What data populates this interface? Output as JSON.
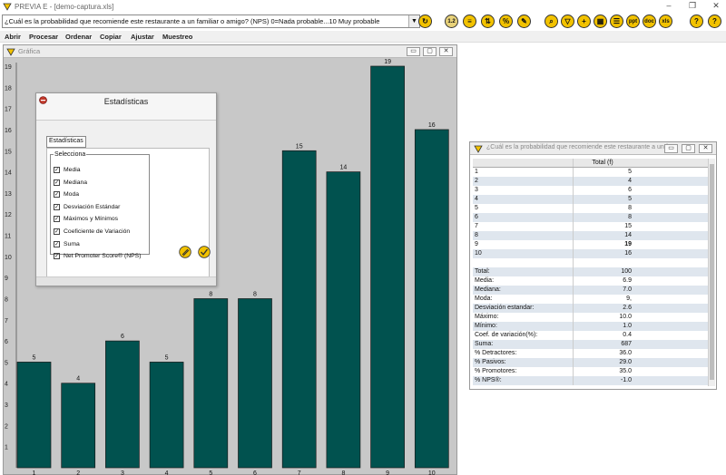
{
  "window": {
    "title": "PREVIA E - [demo-captura.xls]",
    "minimize": "–",
    "restore": "❐",
    "close": "✕"
  },
  "toolbar": {
    "question": "¿Cuál es la probabilidad que recomiende este restaurante a un familiar o amigo? (NPS) 0=Nada probable...10 Muy probable",
    "icons": [
      {
        "name": "refresh-icon",
        "glyph": "↻",
        "color": "#f2c200"
      },
      {
        "name": "scale-icon",
        "glyph": "1.2",
        "color": "#e8d27a"
      },
      {
        "name": "sort-asc-icon",
        "glyph": "≡",
        "color": "#f2c200"
      },
      {
        "name": "sort-desc-icon",
        "glyph": "⇅",
        "color": "#f2c200"
      },
      {
        "name": "percent-icon",
        "glyph": "%",
        "color": "#f2c200"
      },
      {
        "name": "edit-icon",
        "glyph": "✎",
        "color": "#f2c200"
      },
      {
        "name": "search-icon",
        "glyph": "⌕",
        "color": "#f2c200"
      },
      {
        "name": "filter-icon",
        "glyph": "▽",
        "color": "#f2c200"
      },
      {
        "name": "add-icon",
        "glyph": "+",
        "color": "#f2c200"
      },
      {
        "name": "grid-icon",
        "glyph": "▦",
        "color": "#f2c200"
      },
      {
        "name": "list-icon",
        "glyph": "☰",
        "color": "#f2c200"
      },
      {
        "name": "ppt-icon",
        "glyph": "ppt",
        "color": "#f2c200"
      },
      {
        "name": "doc-icon",
        "glyph": "doc",
        "color": "#f2c200"
      },
      {
        "name": "xls-icon",
        "glyph": "xls",
        "color": "#f2c200"
      },
      {
        "name": "help-icon",
        "glyph": "?",
        "color": "#f2c200"
      },
      {
        "name": "help-alt-icon",
        "glyph": "?",
        "color": "#f2c200"
      }
    ]
  },
  "menu": [
    "Abrir",
    "Procesar",
    "Ordenar",
    "Copiar",
    "Ajustar",
    "Muestreo"
  ],
  "chart_window": {
    "title": "Gráfica"
  },
  "chart_data": {
    "type": "bar",
    "categories": [
      "1",
      "2",
      "3",
      "4",
      "5",
      "6",
      "7",
      "8",
      "9",
      "10"
    ],
    "values": [
      5,
      4,
      6,
      5,
      8,
      8,
      15,
      14,
      19,
      16
    ],
    "ylim": [
      0,
      19
    ],
    "y_ticks": [
      "1",
      "2",
      "3",
      "4",
      "5",
      "6",
      "7",
      "8",
      "9",
      "10",
      "11",
      "12",
      "13",
      "14",
      "15",
      "16",
      "17",
      "18",
      "19"
    ],
    "bar_color": "#01524f",
    "grid": false
  },
  "stats_dialog": {
    "title": "Estadísticas",
    "tab": "Estadísticas",
    "legend": "Selecciona",
    "options": [
      {
        "label": "Media",
        "checked": true
      },
      {
        "label": "Mediana",
        "checked": true
      },
      {
        "label": "Moda",
        "checked": true
      },
      {
        "label": "Desviación Estándar",
        "checked": true
      },
      {
        "label": "Máximos y Mínimos",
        "checked": true
      },
      {
        "label": "Coeficiente de Variación",
        "checked": true
      },
      {
        "label": "Suma",
        "checked": true
      },
      {
        "label": "Net Promoter Score® (NPS)",
        "checked": true
      }
    ]
  },
  "table_window": {
    "title": "¿Cuál es la probabilidad que recomiende este restaurante a un fa...",
    "header": "Total (f)",
    "rows": [
      {
        "label": "1",
        "value": "5"
      },
      {
        "label": "2",
        "value": "4"
      },
      {
        "label": "3",
        "value": "6"
      },
      {
        "label": "4",
        "value": "5"
      },
      {
        "label": "5",
        "value": "8"
      },
      {
        "label": "6",
        "value": "8"
      },
      {
        "label": "7",
        "value": "15"
      },
      {
        "label": "8",
        "value": "14"
      },
      {
        "label": "9",
        "value": "19"
      },
      {
        "label": "10",
        "value": "16"
      },
      {
        "label": "",
        "value": ""
      },
      {
        "label": "Total:",
        "value": "100"
      },
      {
        "label": "Media:",
        "value": "6.9"
      },
      {
        "label": "Mediana:",
        "value": "7.0"
      },
      {
        "label": "Moda:",
        "value": "9,"
      },
      {
        "label": "Desviación estandar:",
        "value": "2.6"
      },
      {
        "label": "Máximo:",
        "value": "10.0"
      },
      {
        "label": "Mínimo:",
        "value": "1.0"
      },
      {
        "label": "Coef. de variación(%):",
        "value": "0.4"
      },
      {
        "label": "Suma:",
        "value": "687"
      },
      {
        "label": "% Detractores:",
        "value": "36.0"
      },
      {
        "label": "% Pasivos:",
        "value": "29.0"
      },
      {
        "label": "% Promotores:",
        "value": "35.0"
      },
      {
        "label": "% NPS®:",
        "value": "-1.0"
      }
    ]
  }
}
